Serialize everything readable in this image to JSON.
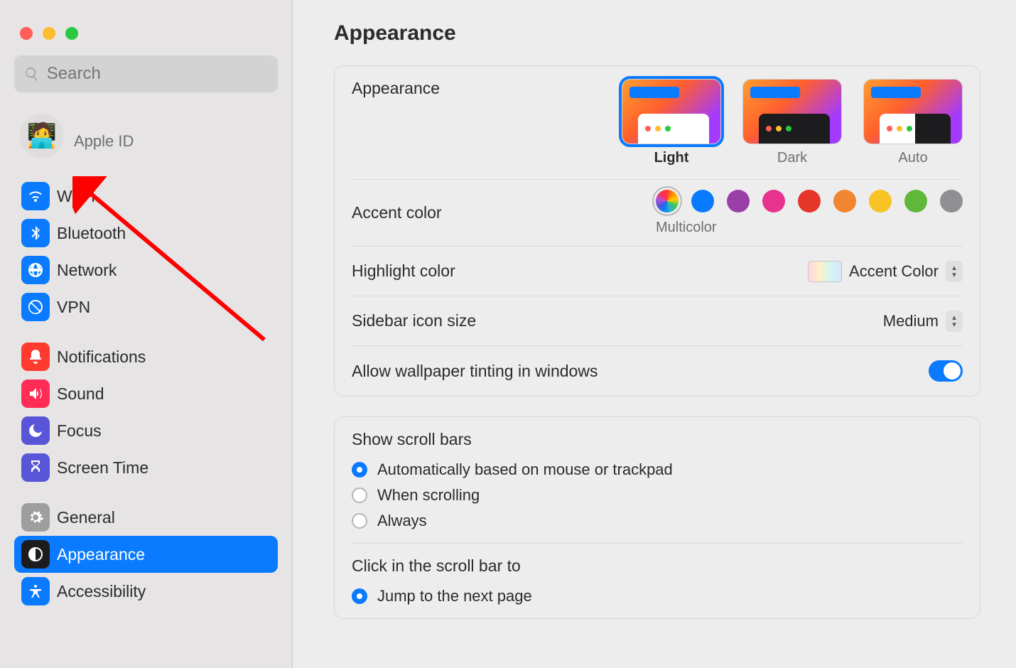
{
  "window": {
    "traffic_lights": [
      "close",
      "minimize",
      "zoom"
    ]
  },
  "search": {
    "placeholder": "Search"
  },
  "profile": {
    "label": "Apple ID"
  },
  "sidebar": {
    "groups": [
      {
        "items": [
          {
            "label": "Wi-Fi",
            "icon": "wifi-icon",
            "selected": false
          },
          {
            "label": "Bluetooth",
            "icon": "bluetooth-icon",
            "selected": false
          },
          {
            "label": "Network",
            "icon": "globe-icon",
            "selected": false
          },
          {
            "label": "VPN",
            "icon": "vpn-icon",
            "selected": false
          }
        ]
      },
      {
        "items": [
          {
            "label": "Notifications",
            "icon": "bell-icon",
            "selected": false
          },
          {
            "label": "Sound",
            "icon": "speaker-icon",
            "selected": false
          },
          {
            "label": "Focus",
            "icon": "moon-icon",
            "selected": false
          },
          {
            "label": "Screen Time",
            "icon": "hourglass-icon",
            "selected": false
          }
        ]
      },
      {
        "items": [
          {
            "label": "General",
            "icon": "gear-icon",
            "selected": false
          },
          {
            "label": "Appearance",
            "icon": "appearance-icon",
            "selected": true
          },
          {
            "label": "Accessibility",
            "icon": "accessibility-icon",
            "selected": false
          }
        ]
      }
    ]
  },
  "main": {
    "title": "Appearance",
    "appearance_row": {
      "label": "Appearance",
      "options": [
        {
          "label": "Light",
          "selected": true
        },
        {
          "label": "Dark",
          "selected": false
        },
        {
          "label": "Auto",
          "selected": false
        }
      ]
    },
    "accent_row": {
      "label": "Accent color",
      "selected_label": "Multicolor",
      "colors": [
        {
          "name": "multicolor",
          "hex": "multi",
          "selected": true
        },
        {
          "name": "blue",
          "hex": "#0a7aff"
        },
        {
          "name": "purple",
          "hex": "#9a3ea8"
        },
        {
          "name": "pink",
          "hex": "#e8338e"
        },
        {
          "name": "red",
          "hex": "#e6352b"
        },
        {
          "name": "orange",
          "hex": "#f2852f"
        },
        {
          "name": "yellow",
          "hex": "#f7c325"
        },
        {
          "name": "green",
          "hex": "#60b83b"
        },
        {
          "name": "graphite",
          "hex": "#8e8e93"
        }
      ]
    },
    "highlight_row": {
      "label": "Highlight color",
      "value": "Accent Color"
    },
    "sidebar_size_row": {
      "label": "Sidebar icon size",
      "value": "Medium"
    },
    "tinting_row": {
      "label": "Allow wallpaper tinting in windows",
      "value": true
    },
    "scrollbars": {
      "title": "Show scroll bars",
      "options": [
        {
          "label": "Automatically based on mouse or trackpad",
          "checked": true
        },
        {
          "label": "When scrolling",
          "checked": false
        },
        {
          "label": "Always",
          "checked": false
        }
      ]
    },
    "scrollclick": {
      "title": "Click in the scroll bar to",
      "options": [
        {
          "label": "Jump to the next page",
          "checked": true
        }
      ]
    }
  }
}
